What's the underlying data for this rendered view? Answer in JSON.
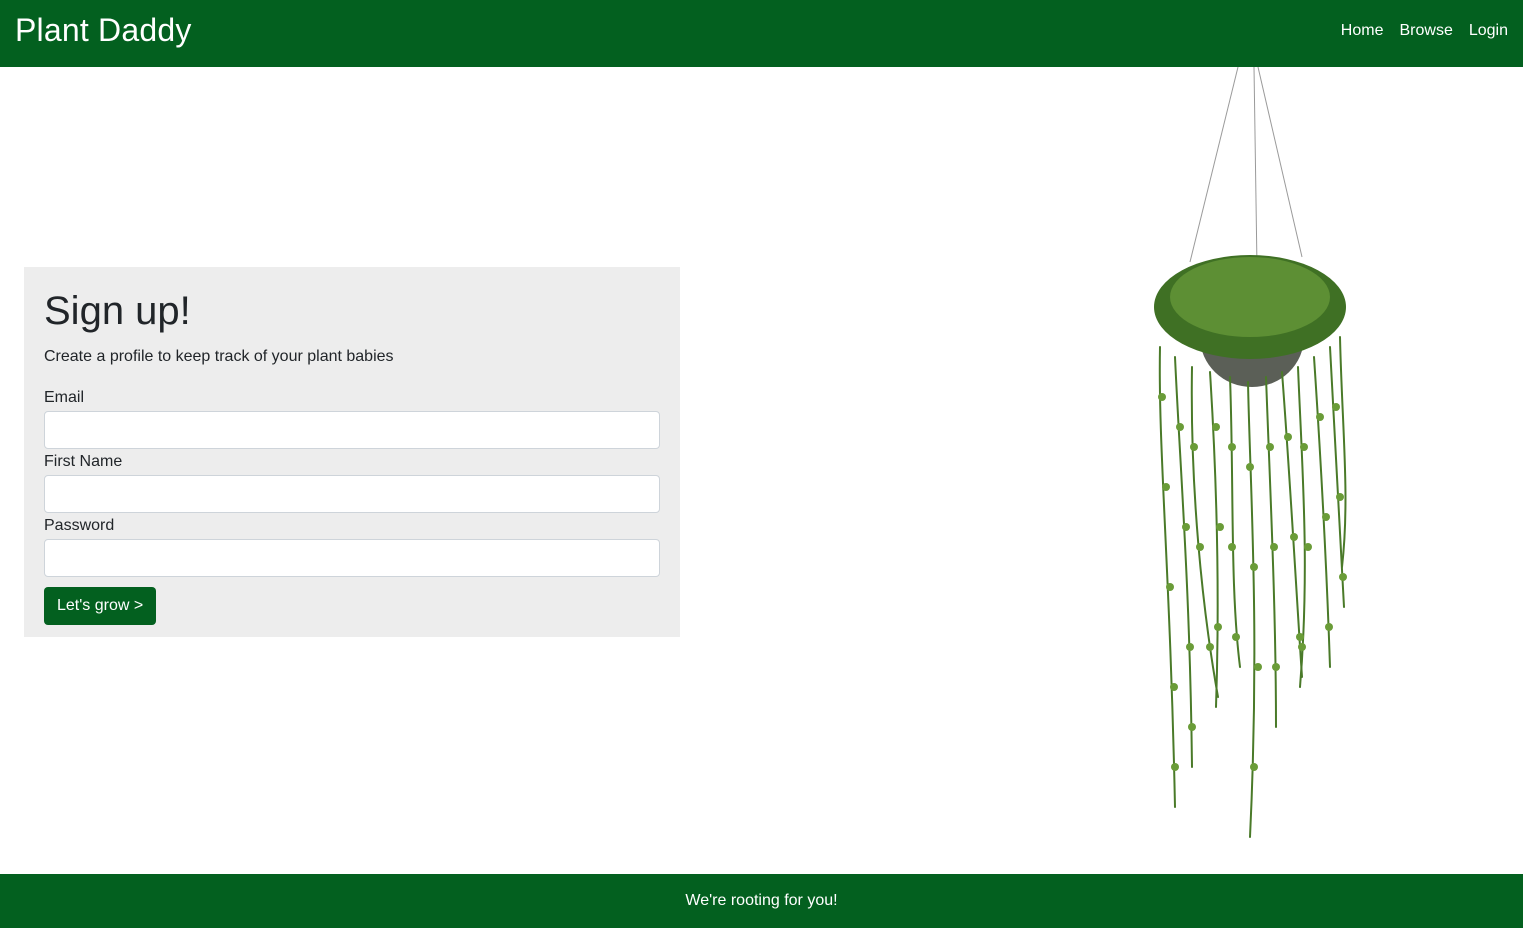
{
  "brand": {
    "title": "Plant Daddy"
  },
  "nav": {
    "items": [
      "Home",
      "Browse",
      "Login"
    ]
  },
  "signup": {
    "title": "Sign up!",
    "subtitle": "Create a profile to keep track of your plant babies",
    "fields": [
      {
        "label": "Email",
        "value": "",
        "placeholder": ""
      },
      {
        "label": "First Name",
        "value": "",
        "placeholder": ""
      },
      {
        "label": "Password",
        "value": "",
        "placeholder": ""
      }
    ],
    "submit_label": "Let's grow >"
  },
  "image": {
    "name": "hanging-plant-image"
  },
  "footer": {
    "text": "We're rooting for you!"
  },
  "colors": {
    "brand_green": "#03601f",
    "card_bg": "#ededed"
  }
}
